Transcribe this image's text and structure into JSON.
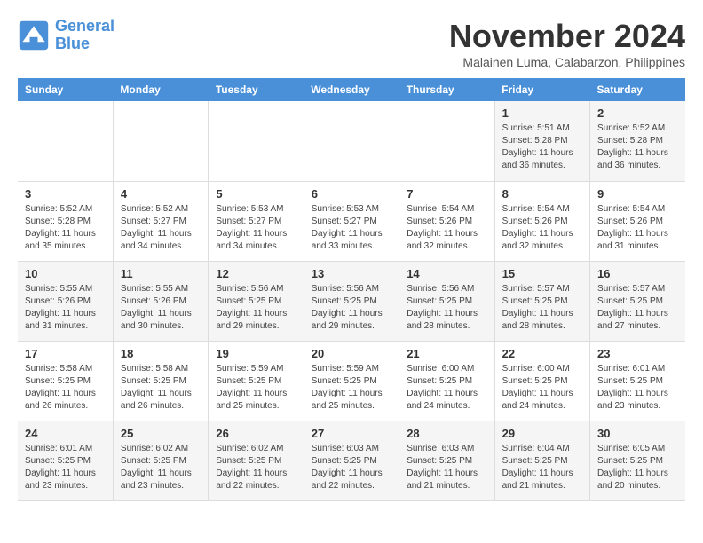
{
  "logo": {
    "line1": "General",
    "line2": "Blue"
  },
  "title": "November 2024",
  "subtitle": "Malainen Luma, Calabarzon, Philippines",
  "days_of_week": [
    "Sunday",
    "Monday",
    "Tuesday",
    "Wednesday",
    "Thursday",
    "Friday",
    "Saturday"
  ],
  "weeks": [
    [
      {
        "day": "",
        "info": ""
      },
      {
        "day": "",
        "info": ""
      },
      {
        "day": "",
        "info": ""
      },
      {
        "day": "",
        "info": ""
      },
      {
        "day": "",
        "info": ""
      },
      {
        "day": "1",
        "info": "Sunrise: 5:51 AM\nSunset: 5:28 PM\nDaylight: 11 hours and 36 minutes."
      },
      {
        "day": "2",
        "info": "Sunrise: 5:52 AM\nSunset: 5:28 PM\nDaylight: 11 hours and 36 minutes."
      }
    ],
    [
      {
        "day": "3",
        "info": "Sunrise: 5:52 AM\nSunset: 5:28 PM\nDaylight: 11 hours and 35 minutes."
      },
      {
        "day": "4",
        "info": "Sunrise: 5:52 AM\nSunset: 5:27 PM\nDaylight: 11 hours and 34 minutes."
      },
      {
        "day": "5",
        "info": "Sunrise: 5:53 AM\nSunset: 5:27 PM\nDaylight: 11 hours and 34 minutes."
      },
      {
        "day": "6",
        "info": "Sunrise: 5:53 AM\nSunset: 5:27 PM\nDaylight: 11 hours and 33 minutes."
      },
      {
        "day": "7",
        "info": "Sunrise: 5:54 AM\nSunset: 5:26 PM\nDaylight: 11 hours and 32 minutes."
      },
      {
        "day": "8",
        "info": "Sunrise: 5:54 AM\nSunset: 5:26 PM\nDaylight: 11 hours and 32 minutes."
      },
      {
        "day": "9",
        "info": "Sunrise: 5:54 AM\nSunset: 5:26 PM\nDaylight: 11 hours and 31 minutes."
      }
    ],
    [
      {
        "day": "10",
        "info": "Sunrise: 5:55 AM\nSunset: 5:26 PM\nDaylight: 11 hours and 31 minutes."
      },
      {
        "day": "11",
        "info": "Sunrise: 5:55 AM\nSunset: 5:26 PM\nDaylight: 11 hours and 30 minutes."
      },
      {
        "day": "12",
        "info": "Sunrise: 5:56 AM\nSunset: 5:25 PM\nDaylight: 11 hours and 29 minutes."
      },
      {
        "day": "13",
        "info": "Sunrise: 5:56 AM\nSunset: 5:25 PM\nDaylight: 11 hours and 29 minutes."
      },
      {
        "day": "14",
        "info": "Sunrise: 5:56 AM\nSunset: 5:25 PM\nDaylight: 11 hours and 28 minutes."
      },
      {
        "day": "15",
        "info": "Sunrise: 5:57 AM\nSunset: 5:25 PM\nDaylight: 11 hours and 28 minutes."
      },
      {
        "day": "16",
        "info": "Sunrise: 5:57 AM\nSunset: 5:25 PM\nDaylight: 11 hours and 27 minutes."
      }
    ],
    [
      {
        "day": "17",
        "info": "Sunrise: 5:58 AM\nSunset: 5:25 PM\nDaylight: 11 hours and 26 minutes."
      },
      {
        "day": "18",
        "info": "Sunrise: 5:58 AM\nSunset: 5:25 PM\nDaylight: 11 hours and 26 minutes."
      },
      {
        "day": "19",
        "info": "Sunrise: 5:59 AM\nSunset: 5:25 PM\nDaylight: 11 hours and 25 minutes."
      },
      {
        "day": "20",
        "info": "Sunrise: 5:59 AM\nSunset: 5:25 PM\nDaylight: 11 hours and 25 minutes."
      },
      {
        "day": "21",
        "info": "Sunrise: 6:00 AM\nSunset: 5:25 PM\nDaylight: 11 hours and 24 minutes."
      },
      {
        "day": "22",
        "info": "Sunrise: 6:00 AM\nSunset: 5:25 PM\nDaylight: 11 hours and 24 minutes."
      },
      {
        "day": "23",
        "info": "Sunrise: 6:01 AM\nSunset: 5:25 PM\nDaylight: 11 hours and 23 minutes."
      }
    ],
    [
      {
        "day": "24",
        "info": "Sunrise: 6:01 AM\nSunset: 5:25 PM\nDaylight: 11 hours and 23 minutes."
      },
      {
        "day": "25",
        "info": "Sunrise: 6:02 AM\nSunset: 5:25 PM\nDaylight: 11 hours and 23 minutes."
      },
      {
        "day": "26",
        "info": "Sunrise: 6:02 AM\nSunset: 5:25 PM\nDaylight: 11 hours and 22 minutes."
      },
      {
        "day": "27",
        "info": "Sunrise: 6:03 AM\nSunset: 5:25 PM\nDaylight: 11 hours and 22 minutes."
      },
      {
        "day": "28",
        "info": "Sunrise: 6:03 AM\nSunset: 5:25 PM\nDaylight: 11 hours and 21 minutes."
      },
      {
        "day": "29",
        "info": "Sunrise: 6:04 AM\nSunset: 5:25 PM\nDaylight: 11 hours and 21 minutes."
      },
      {
        "day": "30",
        "info": "Sunrise: 6:05 AM\nSunset: 5:25 PM\nDaylight: 11 hours and 20 minutes."
      }
    ]
  ]
}
